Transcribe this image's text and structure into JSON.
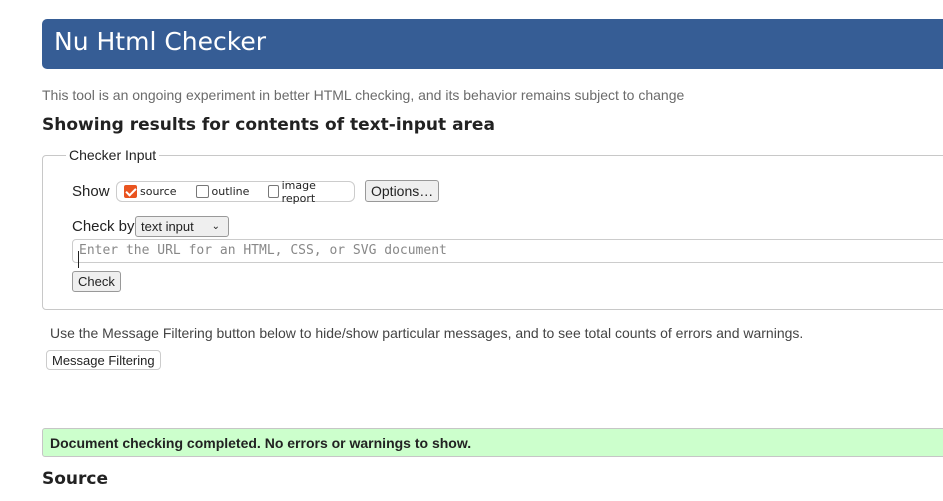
{
  "header": {
    "title": "Nu Html Checker"
  },
  "intro": "This tool is an ongoing experiment in better HTML checking, and its behavior remains subject to change",
  "results_heading": "Showing results for contents of text-input area",
  "checker_input": {
    "legend": "Checker Input",
    "show_label": "Show",
    "show_options": [
      {
        "label": "source",
        "checked": true
      },
      {
        "label": "outline",
        "checked": false
      },
      {
        "label": "image report",
        "checked": false
      }
    ],
    "options_button": "Options…",
    "check_by_label": "Check by",
    "check_by_value": "text input",
    "url_placeholder": "Enter the URL for an HTML, CSS, or SVG document",
    "check_button": "Check"
  },
  "filter_text": "Use the Message Filtering button below to hide/show particular messages, and to see total counts of errors and warnings.",
  "filter_button": "Message Filtering",
  "status_message": "Document checking completed. No errors or warnings to show.",
  "source_heading": "Source",
  "colors": {
    "header": "#365d95",
    "success": "#ccffcc",
    "checkbox": "#e95420"
  }
}
